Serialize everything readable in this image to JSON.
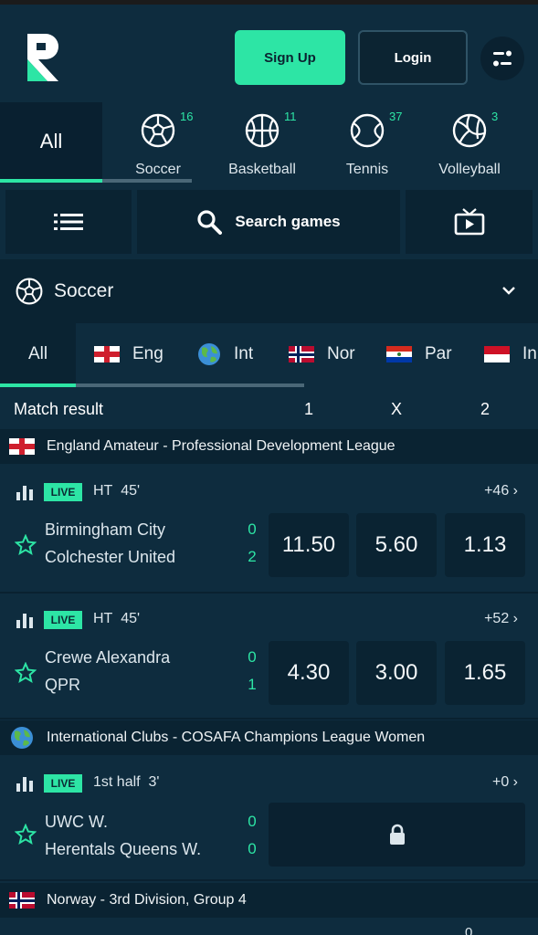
{
  "header": {
    "logo_icon": "r-logo",
    "signup_label": "Sign Up",
    "login_label": "Login",
    "menu_icon": "toggle-icon",
    "accent_color": "#2de5a5"
  },
  "sports": {
    "all_label": "All",
    "items": [
      {
        "label": "Soccer",
        "count": "16",
        "icon": "soccer-ball-icon"
      },
      {
        "label": "Basketball",
        "count": "11",
        "icon": "basketball-icon"
      },
      {
        "label": "Tennis",
        "count": "37",
        "icon": "tennis-ball-icon"
      },
      {
        "label": "Volleyball",
        "count": "3",
        "icon": "volleyball-icon"
      }
    ]
  },
  "toolbar": {
    "list_icon": "list-icon",
    "search_label": "Search games",
    "tv_icon": "live-tv-icon"
  },
  "sport_selector": {
    "label": "Soccer",
    "icon": "soccer-ball-icon"
  },
  "regions": {
    "all_label": "All",
    "items": [
      {
        "label": "Eng",
        "flag": "england"
      },
      {
        "label": "Int",
        "flag": "globe"
      },
      {
        "label": "Nor",
        "flag": "norway"
      },
      {
        "label": "Par",
        "flag": "paraguay"
      },
      {
        "label": "In",
        "flag": "indonesia"
      }
    ]
  },
  "market": {
    "title": "Match result",
    "col1": "1",
    "colx": "X",
    "col2": "2"
  },
  "leagues": [
    {
      "name": "England Amateur - Professional Development League",
      "flag": "england",
      "matches": [
        {
          "live": "LIVE",
          "period": "HT",
          "minute": "45'",
          "more": "+46",
          "home": "Birmingham City",
          "away": "Colchester United",
          "home_score": "0",
          "away_score": "2",
          "odds": [
            "11.50",
            "5.60",
            "1.13"
          ]
        },
        {
          "live": "LIVE",
          "period": "HT",
          "minute": "45'",
          "more": "+52",
          "home": "Crewe Alexandra",
          "away": "QPR",
          "home_score": "0",
          "away_score": "1",
          "odds": [
            "4.30",
            "3.00",
            "1.65"
          ]
        }
      ]
    },
    {
      "name": "International Clubs - COSAFA Champions League Women",
      "flag": "globe",
      "matches": [
        {
          "live": "LIVE",
          "period": "1st half",
          "minute": "3'",
          "more": "+0",
          "home": "UWC W.",
          "away": "Herentals Queens W.",
          "home_score": "0",
          "away_score": "0",
          "locked": true
        }
      ]
    },
    {
      "name": "Norway - 3rd Division, Group 4",
      "flag": "norway"
    }
  ],
  "partial_bottom_text": "0"
}
